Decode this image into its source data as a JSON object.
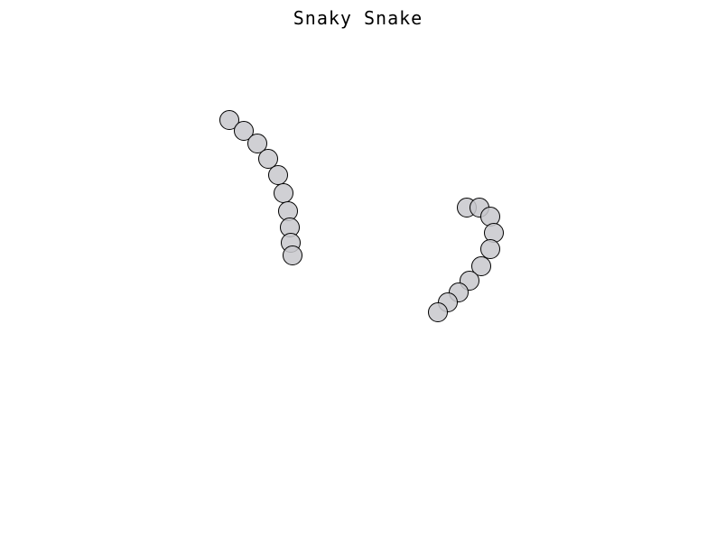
{
  "title": "Snaky Snake",
  "colors": {
    "segment_fill": "#c8c8cd",
    "segment_stroke": "#000000",
    "background": "#ffffff"
  }
}
